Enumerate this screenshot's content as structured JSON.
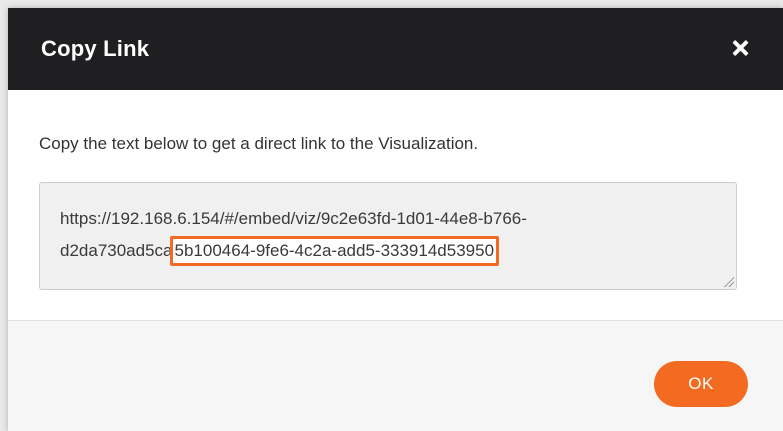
{
  "dialog": {
    "title": "Copy Link",
    "description": "Copy the text below to get a direct link to the Visualization.",
    "link": {
      "line1": "https://192.168.6.154/#/embed/viz/9c2e63fd-1d01-44e8-b766-",
      "line2_prefix": "d2da730ad5ca",
      "line2_highlighted": "5b100464-9fe6-4c2a-add5-333914d53950"
    },
    "ok_label": "OK"
  },
  "colors": {
    "header_bg": "#1f1f21",
    "accent": "#f26b21",
    "footer_bg": "#f6f6f6",
    "link_box_bg": "#f0f0f0"
  },
  "icons": {
    "close": "close-icon",
    "resize": "resize-grip-icon"
  }
}
